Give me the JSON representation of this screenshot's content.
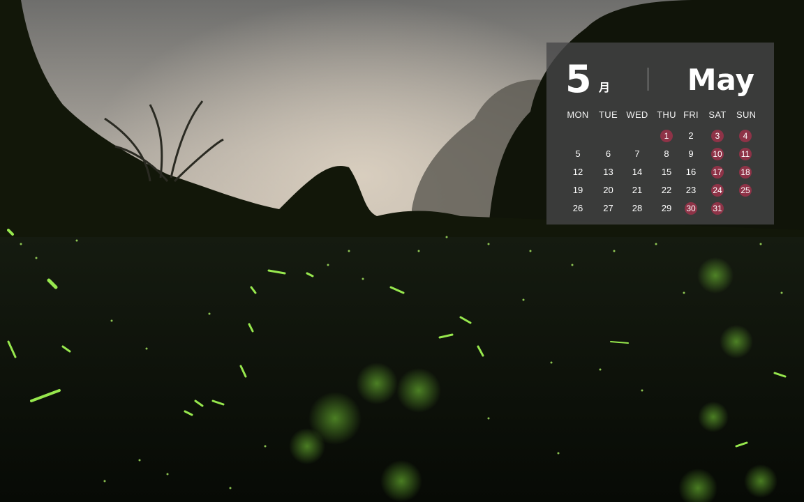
{
  "calendar": {
    "month_number": "5",
    "month_kanji": "月",
    "month_name": "May",
    "weekdays": [
      "MON",
      "TUE",
      "WED",
      "THU",
      "FRI",
      "SAT",
      "SUN"
    ],
    "weeks": [
      [
        "",
        "",
        "",
        "1",
        "2",
        "3",
        "4"
      ],
      [
        "5",
        "6",
        "7",
        "8",
        "9",
        "10",
        "11"
      ],
      [
        "12",
        "13",
        "14",
        "15",
        "16",
        "17",
        "18"
      ],
      [
        "19",
        "20",
        "21",
        "22",
        "23",
        "24",
        "25"
      ],
      [
        "26",
        "27",
        "28",
        "29",
        "30",
        "31",
        ""
      ]
    ],
    "highlighted_days": [
      "1",
      "3",
      "4",
      "10",
      "11",
      "17",
      "18",
      "24",
      "25",
      "30",
      "31"
    ],
    "highlight_color": "#8e3347"
  },
  "wallpaper": {
    "subject": "fireflies-in-forest-at-dusk",
    "sky_color": "#b8b2a8",
    "foliage_color": "#0d120a",
    "firefly_color": "#9cff4a"
  }
}
